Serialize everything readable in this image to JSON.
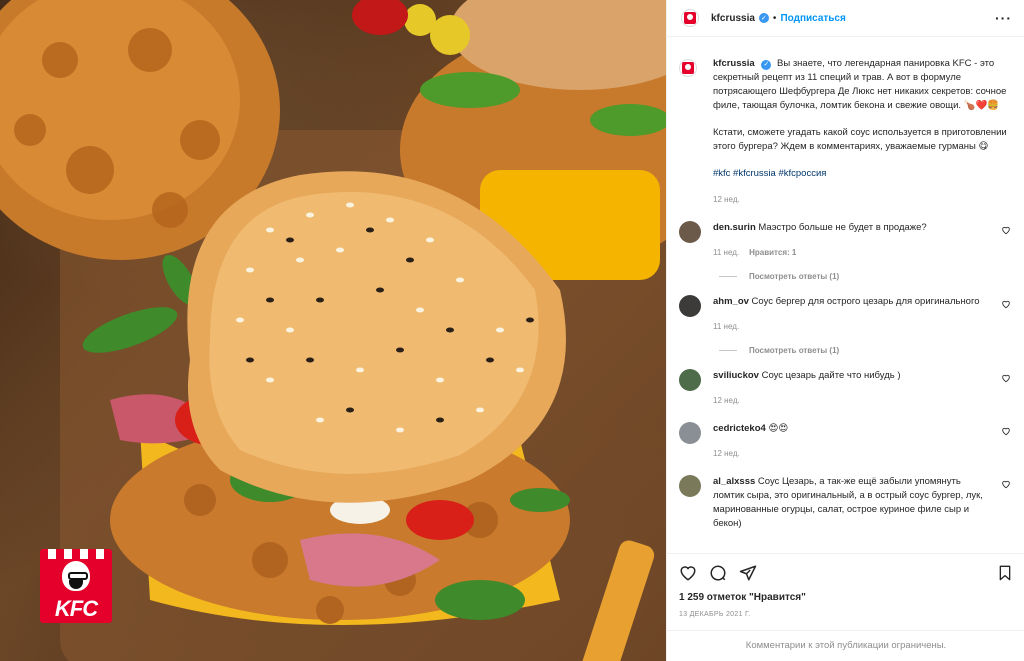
{
  "photo": {
    "alt_icon": "kfc-logo-icon",
    "logo_text": "KFC"
  },
  "header": {
    "username": "kfcrussia",
    "separator": "•",
    "follow_label": "Подписаться",
    "more_label": "···"
  },
  "caption": {
    "username": "kfcrussia",
    "text1": "Вы знаете, что легендарная панировка KFC - это секретный рецепт из 11 специй и трав. А вот в формуле потрясающего Шефбургера Де Люкс нет никаких секретов: сочное филе, тающая булочка, ломтик бекона и свежие овощи. 🍗❤️🍔",
    "text2": "Кстати, сможете угадать какой соус используется в приготовлении этого бургера? Ждем в комментариях, уважаемые гурманы 😋",
    "hashtags": "#kfc #kfcrussia #kfcроссия",
    "time": "12 нед."
  },
  "comments": [
    {
      "username": "den.surin",
      "text": "Маэстро больше не будет в продаже?",
      "time": "11 нед.",
      "likes": "Нравится: 1",
      "replies": "Посмотреть ответы (1)",
      "avatar_color": "#6b5a4a"
    },
    {
      "username": "ahm_ov",
      "text": "Соус бергер для острого цезарь для оригинального",
      "time": "11 нед.",
      "likes": "",
      "replies": "Посмотреть ответы (1)",
      "avatar_color": "#3d3a3a"
    },
    {
      "username": "sviliuckov",
      "text": "Соус цезарь дайте что нибудь )",
      "time": "12 нед.",
      "likes": "",
      "replies": "",
      "avatar_color": "#4e6b4a"
    },
    {
      "username": "cedricteko4",
      "text": "😍😍",
      "time": "12 нед.",
      "likes": "",
      "replies": "",
      "avatar_color": "#8a8f96"
    },
    {
      "username": "al_alxsss",
      "text": "Соус Цезарь, а так-же ещё забыли упомянуть ломтик сыра, это оригинальный, а в острый соус бургер, лук, маринованные огурцы, салат, острое куриное филе сыр и бекон)",
      "time": "",
      "likes": "",
      "replies": "",
      "avatar_color": "#7a7a5a"
    }
  ],
  "actions": {
    "likes": "1 259 отметок \"Нравится\"",
    "date": "13 ДЕКАБРЬ 2021 Г.",
    "restricted": "Комментарии к этой публикации ограничены."
  },
  "colors": {
    "accent": "#0095f6",
    "verified": "#3897f0",
    "brand_red": "#e4002b",
    "hashtag": "#00376b"
  }
}
